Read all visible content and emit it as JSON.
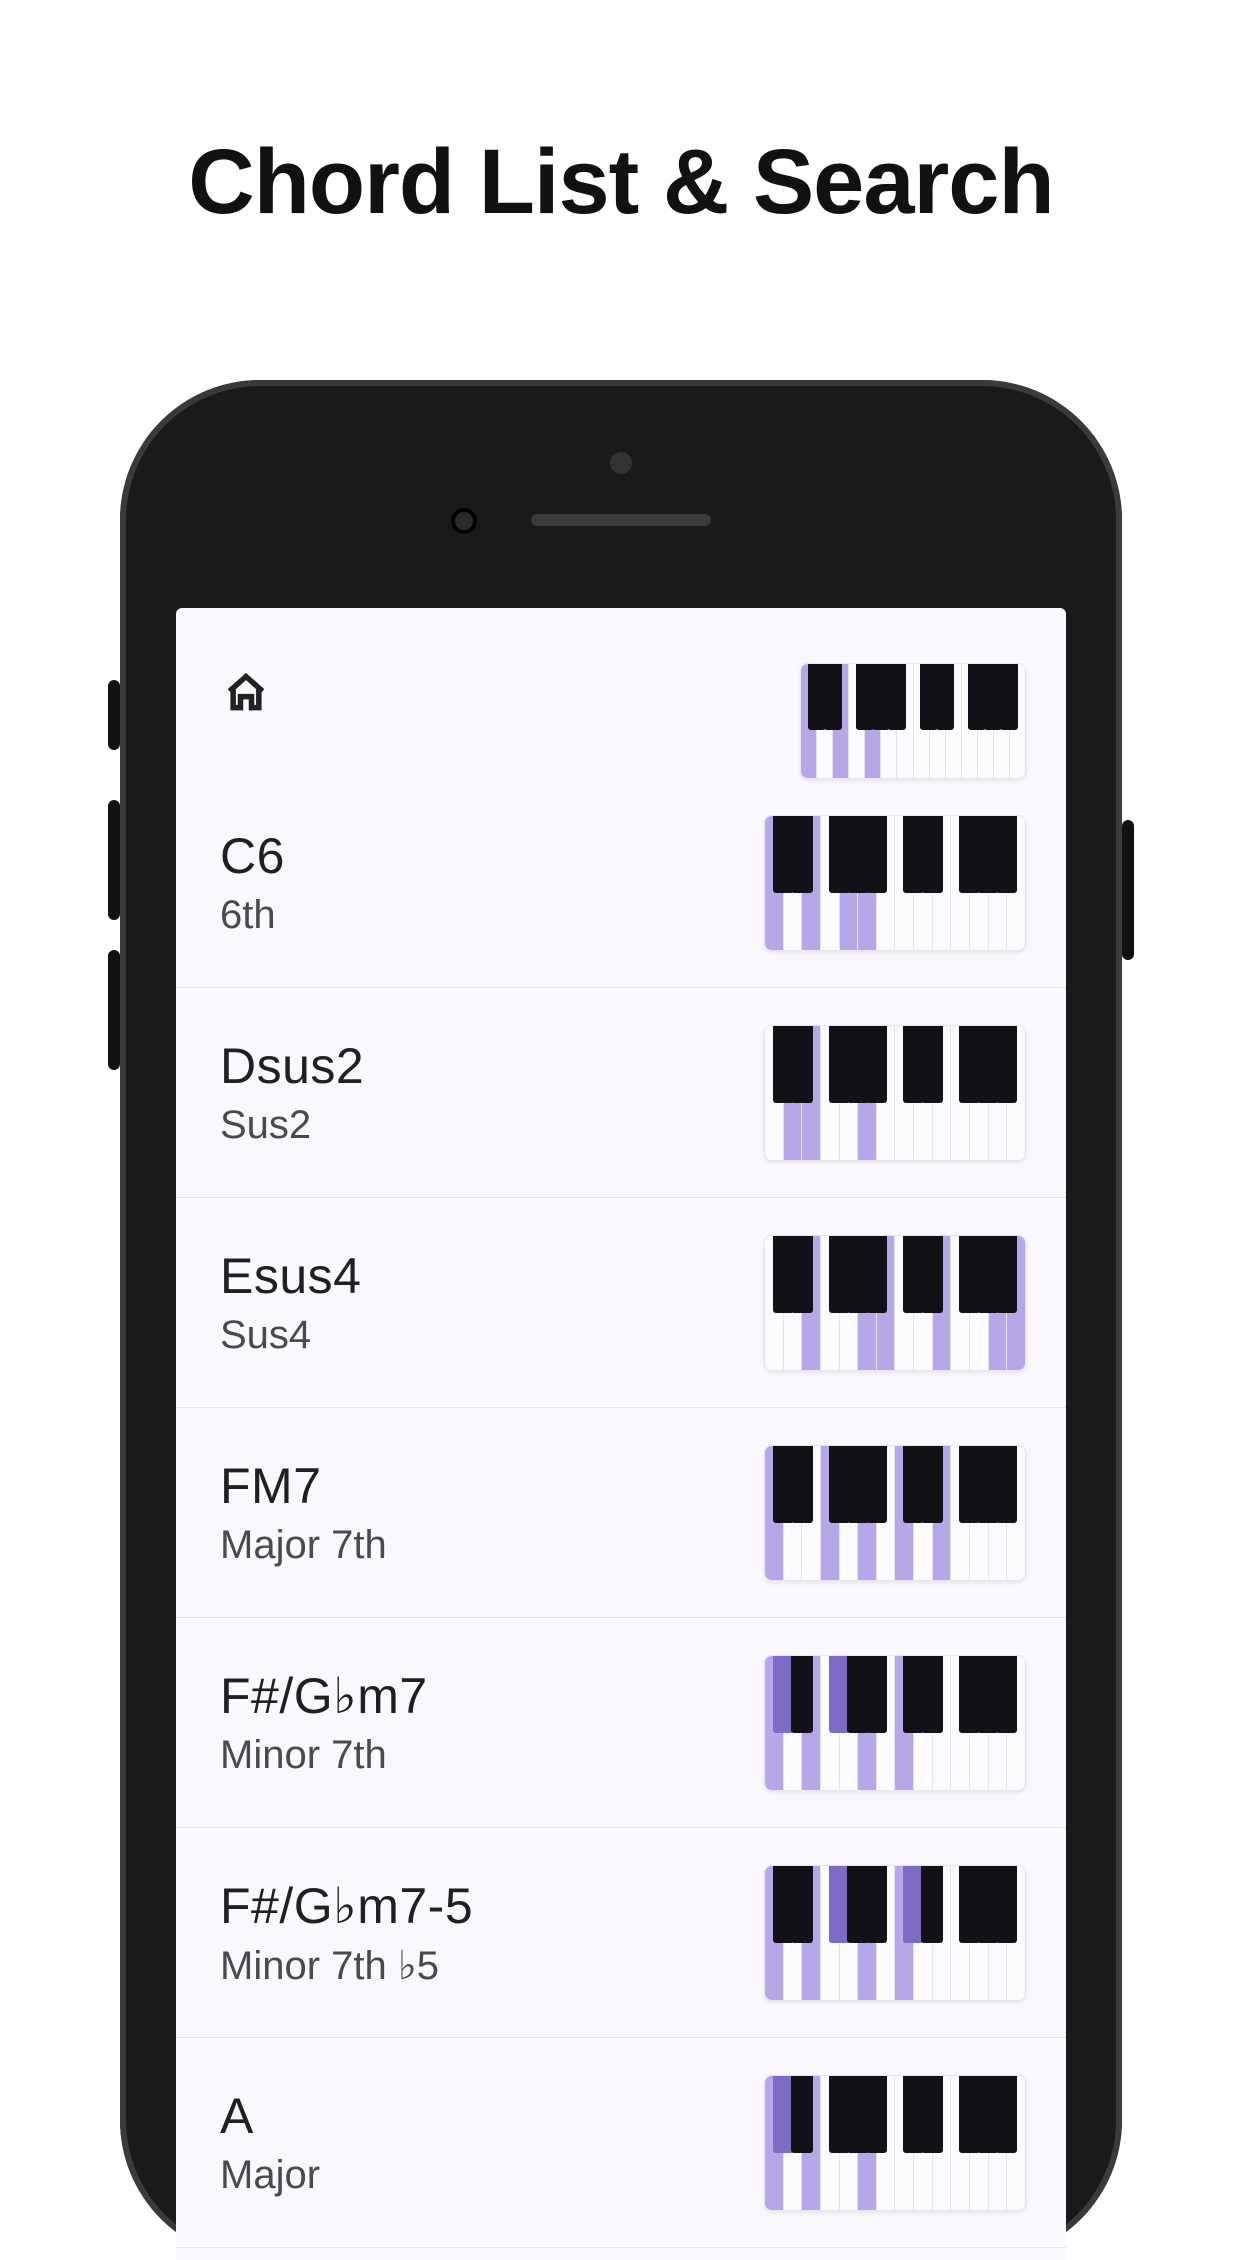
{
  "page_title": "Chord List & Search",
  "header_keyboard": {
    "white_hl": [
      0,
      2,
      4
    ],
    "black_hl": []
  },
  "chords": [
    {
      "name": "C6",
      "sub": "6th",
      "white_hl": [
        0,
        2,
        4,
        5
      ],
      "black_hl": []
    },
    {
      "name": "Dsus2",
      "sub": "Sus2",
      "white_hl": [
        1,
        2,
        5
      ],
      "black_hl": []
    },
    {
      "name": "Esus4",
      "sub": "Sus4",
      "white_hl": [
        2,
        5,
        6,
        9,
        12,
        13
      ],
      "black_hl": []
    },
    {
      "name": "FM7",
      "sub": "Major 7th",
      "white_hl": [
        0,
        3,
        5,
        7,
        9
      ],
      "black_hl": []
    },
    {
      "name": "F#/G♭m7",
      "sub": "Minor 7th",
      "white_hl": [
        0,
        2,
        5,
        7
      ],
      "black_hl": [
        0,
        2
      ]
    },
    {
      "name": "F#/G♭m7-5",
      "sub": "Minor 7th ♭5",
      "white_hl": [
        0,
        2,
        5,
        7
      ],
      "black_hl": [
        2,
        5
      ]
    },
    {
      "name": "A",
      "sub": "Major",
      "white_hl": [
        0,
        2,
        5
      ],
      "black_hl": [
        0
      ]
    }
  ],
  "colors": {
    "highlight": "#b6a7e8",
    "highlight_black": "#7e6bc6"
  }
}
